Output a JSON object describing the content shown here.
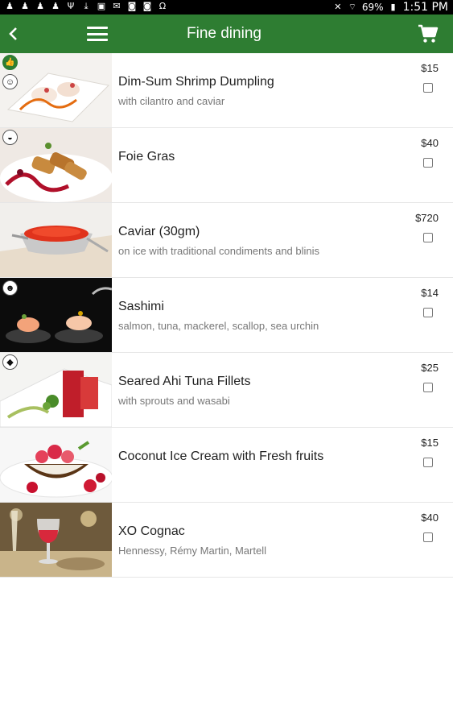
{
  "status_bar": {
    "battery": "69%",
    "time": "1:51 PM"
  },
  "app_bar": {
    "title": "Fine dining",
    "back_icon": "chevron-left-icon",
    "menu_icon": "hamburger-menu-icon",
    "cart_icon": "shopping-cart-icon"
  },
  "colors": {
    "primary": "#2e7d32",
    "status_bar": "#000000"
  },
  "items": [
    {
      "name": "Dim-Sum Shrimp Dumpling",
      "description": "with cilantro and caviar",
      "price": "$15",
      "checked": false
    },
    {
      "name": "Foie Gras",
      "description": "",
      "price": "$40",
      "checked": false
    },
    {
      "name": "Caviar (30gm)",
      "description": "on ice with traditional condiments and blinis",
      "price": "$720",
      "checked": false
    },
    {
      "name": "Sashimi",
      "description": "salmon, tuna, mackerel, scallop, sea urchin",
      "price": "$14",
      "checked": false
    },
    {
      "name": "Seared Ahi Tuna Fillets",
      "description": "with sprouts and wasabi",
      "price": "$25",
      "checked": false
    },
    {
      "name": "Coconut Ice Cream with Fresh fruits",
      "description": "",
      "price": "$15",
      "checked": false
    },
    {
      "name": "XO Cognac",
      "description": "Hennessy, Rémy Martin, Martell",
      "price": "$40",
      "checked": false
    }
  ]
}
